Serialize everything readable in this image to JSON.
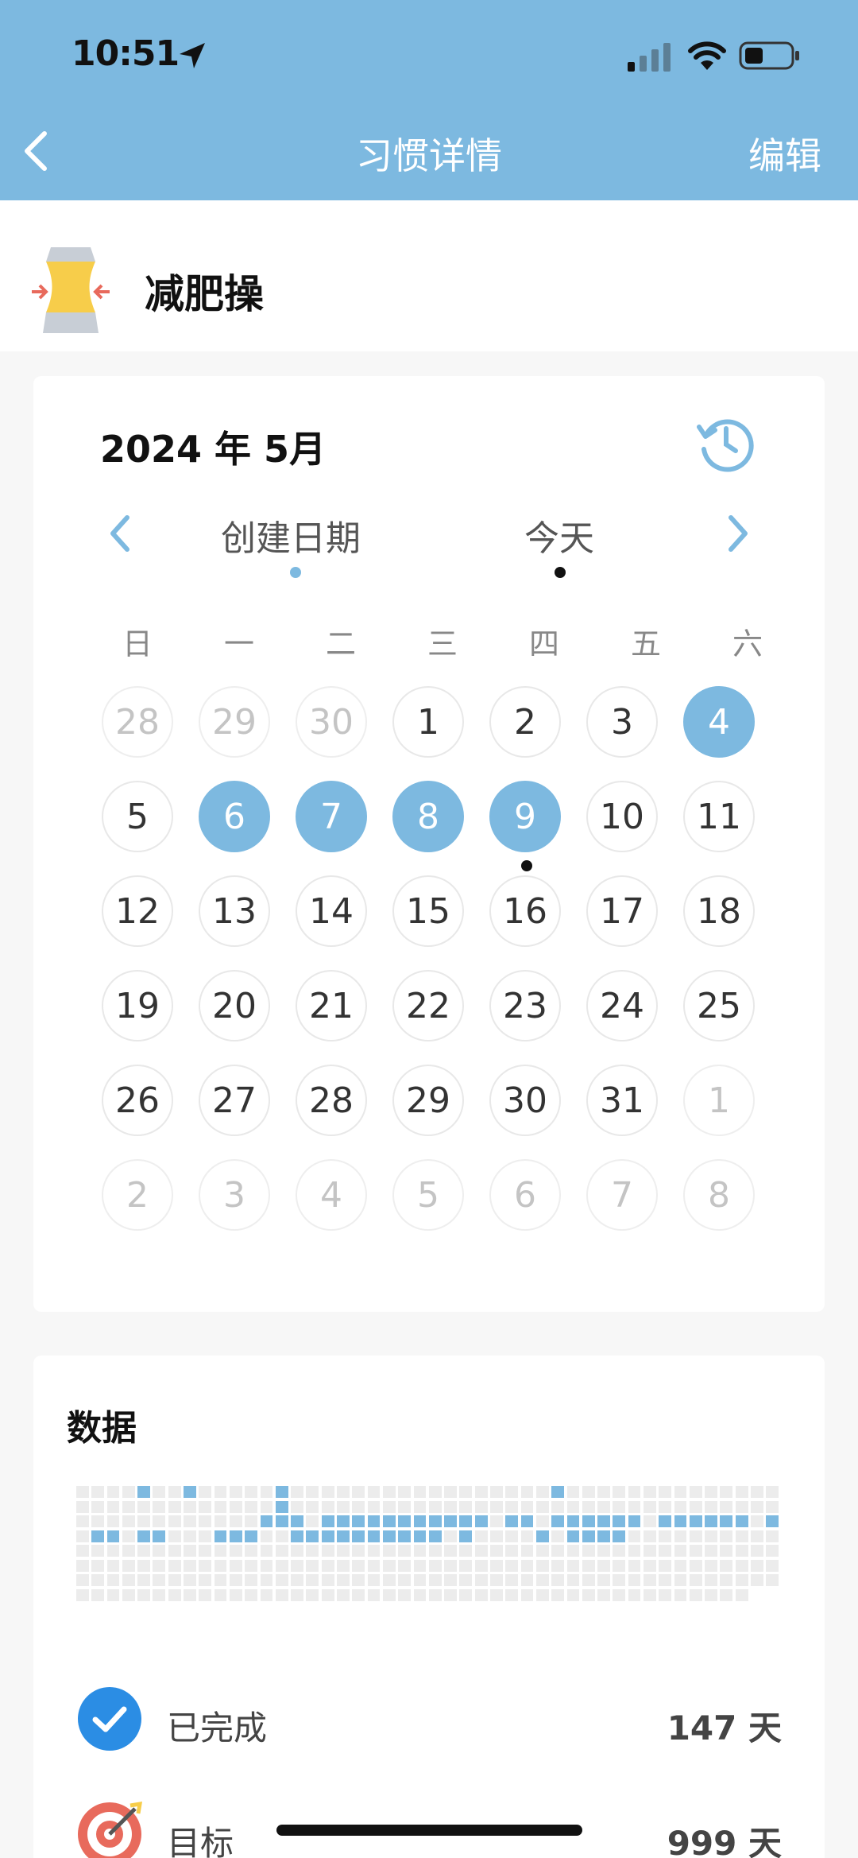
{
  "status_bar": {
    "time": "10:51"
  },
  "nav": {
    "title": "习惯详情",
    "edit_label": "编辑"
  },
  "habit": {
    "name": "减肥操"
  },
  "calendar": {
    "month_title": "2024 年 5月",
    "created_label": "创建日期",
    "today_label": "今天",
    "weekdays": [
      "日",
      "一",
      "二",
      "三",
      "四",
      "五",
      "六"
    ],
    "days": [
      {
        "n": "28",
        "muted": true
      },
      {
        "n": "29",
        "muted": true
      },
      {
        "n": "30",
        "muted": true
      },
      {
        "n": "1"
      },
      {
        "n": "2"
      },
      {
        "n": "3"
      },
      {
        "n": "4",
        "done": true
      },
      {
        "n": "5"
      },
      {
        "n": "6",
        "done": true
      },
      {
        "n": "7",
        "done": true
      },
      {
        "n": "8",
        "done": true
      },
      {
        "n": "9",
        "done": true,
        "today": true
      },
      {
        "n": "10"
      },
      {
        "n": "11"
      },
      {
        "n": "12"
      },
      {
        "n": "13"
      },
      {
        "n": "14"
      },
      {
        "n": "15"
      },
      {
        "n": "16"
      },
      {
        "n": "17"
      },
      {
        "n": "18"
      },
      {
        "n": "19"
      },
      {
        "n": "20"
      },
      {
        "n": "21"
      },
      {
        "n": "22"
      },
      {
        "n": "23"
      },
      {
        "n": "24"
      },
      {
        "n": "25"
      },
      {
        "n": "26"
      },
      {
        "n": "27"
      },
      {
        "n": "28"
      },
      {
        "n": "29"
      },
      {
        "n": "30"
      },
      {
        "n": "31"
      },
      {
        "n": "1",
        "muted": true
      },
      {
        "n": "2",
        "muted": true
      },
      {
        "n": "3",
        "muted": true
      },
      {
        "n": "4",
        "muted": true
      },
      {
        "n": "5",
        "muted": true
      },
      {
        "n": "6",
        "muted": true
      },
      {
        "n": "7",
        "muted": true
      },
      {
        "n": "8",
        "muted": true
      }
    ]
  },
  "data_section": {
    "title": "数据",
    "heatmap_rows": [
      "0000100100000100000000000000000100000000000000",
      "0000000000000100000000000000000000000000000000",
      "0000000000001110111111111110110111111011111101",
      "0110110001110011111111110100001011110000000000",
      "0000000000000000000000000000000000000000000000",
      "0000000000000000000000000000000000000000000000",
      "0000000000000000000000000000000000000000000000",
      "0000000000000000000000000000000000000000000000"
    ],
    "completed": {
      "label": "已完成",
      "value": "147 天"
    },
    "goal": {
      "label": "目标",
      "value": "999 天"
    }
  },
  "colors": {
    "accent": "#7db9e0",
    "check_blue": "#2b8de4",
    "target_red": "#e86a5c"
  }
}
